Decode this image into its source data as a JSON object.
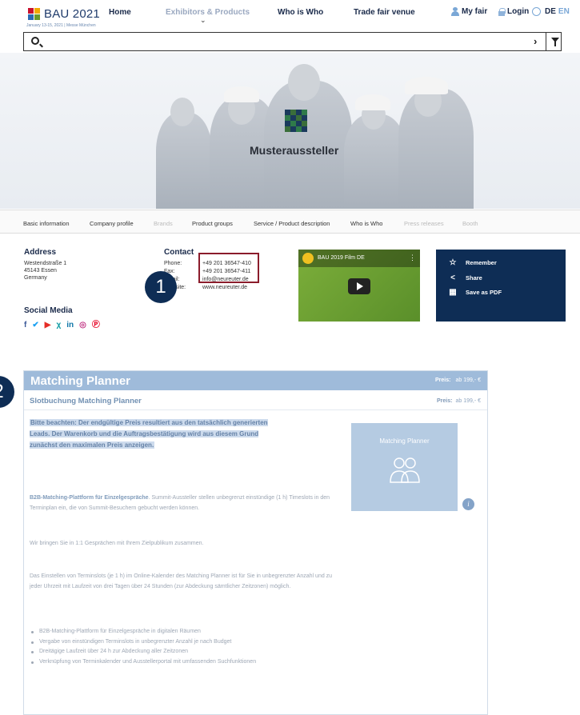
{
  "header": {
    "logo_text": "BAU 2021",
    "logo_sub": "January 13-15, 2021 | Messe München",
    "nav": {
      "home": "Home",
      "exhibitors": "Exhibitors & Products",
      "who_is_who": "Who is Who",
      "venue": "Trade fair venue"
    },
    "my_fair": "My fair",
    "login": "Login",
    "lang_de": "DE",
    "lang_en": "EN"
  },
  "search": {
    "placeholder": ""
  },
  "hero": {
    "exhibitor_name": "Musteraussteller"
  },
  "tabs": {
    "basic": "Basic information",
    "company": "Company profile",
    "brands": "Brands",
    "groups": "Product groups",
    "service": "Service / Product description",
    "who": "Who is Who",
    "press": "Press releases",
    "booth": "Booth"
  },
  "address": {
    "heading": "Address",
    "street": "Westendstraße 1",
    "city": "45143 Essen",
    "country": "Germany"
  },
  "contact": {
    "heading": "Contact",
    "phone_label": "Phone:",
    "phone": "+49 201 36547-410",
    "fax_label": "Fax:",
    "fax": "+49 201 36547-411",
    "email_label": "Email:",
    "email": "info@neureuter.de",
    "web_label": "Website:",
    "web": "www.neureuter.de"
  },
  "social": {
    "heading": "Social Media",
    "icons": [
      "facebook-icon",
      "twitter-icon",
      "youtube-icon",
      "xing-icon",
      "linkedin-icon",
      "instagram-icon",
      "pinterest-icon"
    ]
  },
  "video": {
    "title": "BAU 2019 Film DE"
  },
  "actions": {
    "remember": "Remember",
    "share": "Share",
    "pdf": "Save as PDF"
  },
  "badges": {
    "one": "1",
    "two": "2"
  },
  "planner": {
    "title": "Matching Planner",
    "price_label": "Preis:",
    "price_value": "ab 199,- €",
    "subtitle": "Slotbuchung Matching Planner",
    "notice": "Bitte beachten: Der endgültige Preis resultiert aus den tatsächlich generierten Leads. Der Warenkorb und die Auftragsbestätigung wird aus diesem Grund zunächst den maximalen Preis anzeigen.",
    "intro_bold": "B2B-Matching-Plattform für Einzelgespräche",
    "intro_rest": ". Summit-Aussteller stellen unbegrenzt einstündige (1 h) Timeslots in den Terminplan ein, die von Summit-Besuchern gebucht werden können.",
    "para2": "Wir bringen Sie in 1:1 Gesprächen mit Ihrem Zielpublikum zusammen.",
    "para3": "Das Einstellen von Terminslots (je 1 h) im Online-Kalender des Matching Planner ist für Sie in unbegrenzter Anzahl und zu jeder Uhrzeit mit Laufzeit von drei Tagen über 24 Stunden (zur Abdeckung sämtlicher Zeitzonen) möglich.",
    "bullets": [
      "B2B-Matching-Plattform für Einzelgespräche in digitalen Räumen",
      "Vergabe von einstündigen Terminslots in unbegrenzter Anzahl je nach Budget",
      "Dreitägige Laufzeit über 24 h zur Abdeckung aller Zeitzonen",
      "Verknüpfung von Terminkalender und Ausstellerportal mit umfassenden Suchfunktionen"
    ],
    "card_label": "Matching Planner"
  },
  "colors": {
    "navy": "#0e2d55",
    "planner_blue": "#8fb0d4",
    "highlight": "#8b1c2b"
  }
}
